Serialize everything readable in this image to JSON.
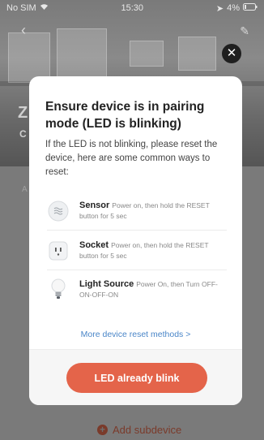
{
  "status_bar": {
    "carrier": "No SIM",
    "time": "15:30",
    "battery": "4%"
  },
  "background": {
    "title_fragment": "Z",
    "subtitle_fragment": "C",
    "section_fragment": "A",
    "add_subdevice_label": "Add subdevice"
  },
  "modal": {
    "title": "Ensure device is in pairing mode (LED is blinking)",
    "description": "If the LED is not blinking, please reset the device, here are some common ways to reset:",
    "methods": [
      {
        "icon": "sensor-icon",
        "name": "Sensor",
        "instruction": "Power on, then hold the RESET button for 5 sec"
      },
      {
        "icon": "socket-icon",
        "name": "Socket",
        "instruction": "Power on, then hold the RESET button for 5 sec"
      },
      {
        "icon": "light-bulb-icon",
        "name": "Light Source",
        "instruction": "Power On, then Turn OFF-ON-OFF-ON"
      }
    ],
    "more_link": "More device reset methods >",
    "primary_button": "LED already blink"
  },
  "colors": {
    "accent": "#e4644a",
    "link": "#4a86c8",
    "overlay": "#6f6f6f"
  }
}
